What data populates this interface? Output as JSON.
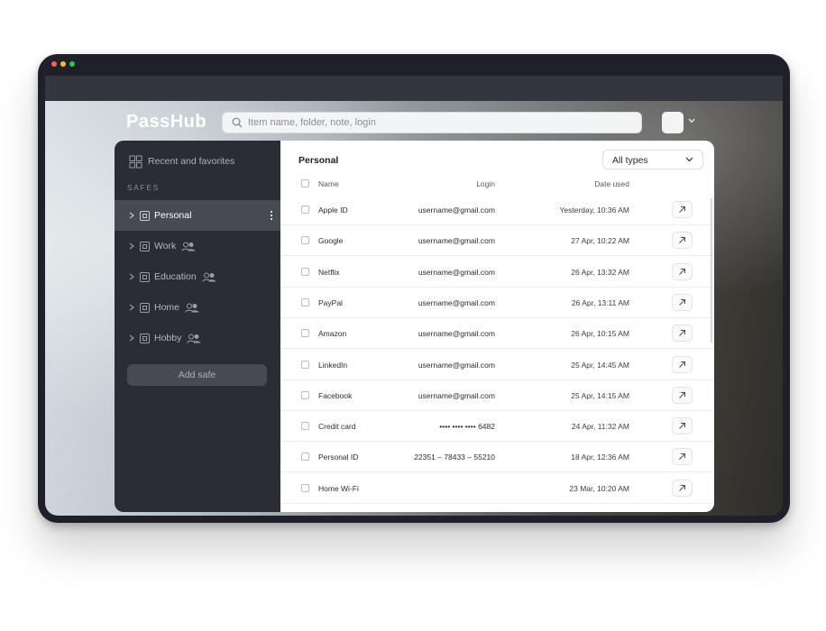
{
  "window_dots": [
    "#ff5f57",
    "#febc2e",
    "#28c840"
  ],
  "app": {
    "logo": "PassHub"
  },
  "search": {
    "placeholder": "Item name, folder, note, login"
  },
  "sidebar": {
    "recent_label": "Recent and favorites",
    "safes_title": "SAFES",
    "safes": [
      {
        "label": "Personal",
        "active": true,
        "shared": false
      },
      {
        "label": "Work",
        "active": false,
        "shared": true
      },
      {
        "label": "Education",
        "active": false,
        "shared": true
      },
      {
        "label": "Home",
        "active": false,
        "shared": true
      },
      {
        "label": "Hobby",
        "active": false,
        "shared": true
      }
    ],
    "add_safe_label": "Add safe"
  },
  "main": {
    "title": "Personal",
    "type_filter": "All types",
    "columns": {
      "name": "Name",
      "login": "Login",
      "date": "Date used"
    },
    "rows": [
      {
        "name": "Apple ID",
        "login": "username@gmail.com",
        "date": "Yesterday, 10:36 AM"
      },
      {
        "name": "Google",
        "login": "username@gmail.com",
        "date": "27 Apr, 10:22 AM"
      },
      {
        "name": "Netflix",
        "login": "username@gmail.com",
        "date": "26 Apr, 13:32 AM"
      },
      {
        "name": "PayPal",
        "login": "username@gmail.com",
        "date": "26 Apr, 13:11 AM"
      },
      {
        "name": "Amazon",
        "login": "username@gmail.com",
        "date": "26 Apr, 10:15 AM"
      },
      {
        "name": "LinkedIn",
        "login": "username@gmail.com",
        "date": "25 Apr, 14:45 AM"
      },
      {
        "name": "Facebook",
        "login": "username@gmail.com",
        "date": "25 Apr, 14:15 AM"
      },
      {
        "name": "Credit card",
        "login": "••••   ••••   ••••   6482",
        "date": "24 Apr, 11:32 AM"
      },
      {
        "name": "Personal ID",
        "login": "22351 – 78433 – 55210",
        "date": "18 Apr, 12:36 AM"
      },
      {
        "name": "Home Wi-Fi",
        "login": "",
        "date": "23 Mar, 10:20 AM"
      }
    ]
  },
  "colors": {
    "sidebar_bg": "#2b2c35",
    "active_bg": "#474953",
    "device_frame": "#1f2029"
  }
}
